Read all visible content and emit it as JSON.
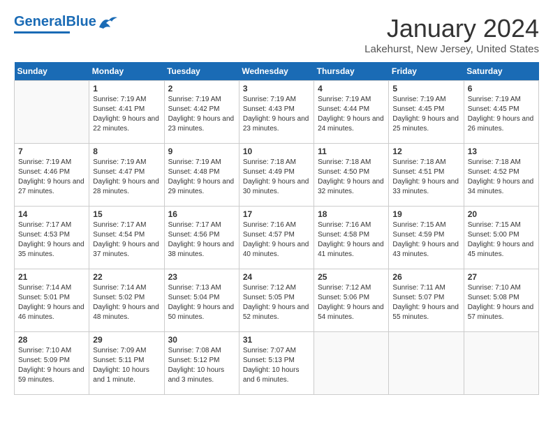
{
  "header": {
    "logo_general": "General",
    "logo_blue": "Blue",
    "month": "January 2024",
    "location": "Lakehurst, New Jersey, United States"
  },
  "weekdays": [
    "Sunday",
    "Monday",
    "Tuesday",
    "Wednesday",
    "Thursday",
    "Friday",
    "Saturday"
  ],
  "weeks": [
    [
      {
        "day": "",
        "sunrise": "",
        "sunset": "",
        "daylight": ""
      },
      {
        "day": "1",
        "sunrise": "Sunrise: 7:19 AM",
        "sunset": "Sunset: 4:41 PM",
        "daylight": "Daylight: 9 hours and 22 minutes."
      },
      {
        "day": "2",
        "sunrise": "Sunrise: 7:19 AM",
        "sunset": "Sunset: 4:42 PM",
        "daylight": "Daylight: 9 hours and 23 minutes."
      },
      {
        "day": "3",
        "sunrise": "Sunrise: 7:19 AM",
        "sunset": "Sunset: 4:43 PM",
        "daylight": "Daylight: 9 hours and 23 minutes."
      },
      {
        "day": "4",
        "sunrise": "Sunrise: 7:19 AM",
        "sunset": "Sunset: 4:44 PM",
        "daylight": "Daylight: 9 hours and 24 minutes."
      },
      {
        "day": "5",
        "sunrise": "Sunrise: 7:19 AM",
        "sunset": "Sunset: 4:45 PM",
        "daylight": "Daylight: 9 hours and 25 minutes."
      },
      {
        "day": "6",
        "sunrise": "Sunrise: 7:19 AM",
        "sunset": "Sunset: 4:45 PM",
        "daylight": "Daylight: 9 hours and 26 minutes."
      }
    ],
    [
      {
        "day": "7",
        "sunrise": "Sunrise: 7:19 AM",
        "sunset": "Sunset: 4:46 PM",
        "daylight": "Daylight: 9 hours and 27 minutes."
      },
      {
        "day": "8",
        "sunrise": "Sunrise: 7:19 AM",
        "sunset": "Sunset: 4:47 PM",
        "daylight": "Daylight: 9 hours and 28 minutes."
      },
      {
        "day": "9",
        "sunrise": "Sunrise: 7:19 AM",
        "sunset": "Sunset: 4:48 PM",
        "daylight": "Daylight: 9 hours and 29 minutes."
      },
      {
        "day": "10",
        "sunrise": "Sunrise: 7:18 AM",
        "sunset": "Sunset: 4:49 PM",
        "daylight": "Daylight: 9 hours and 30 minutes."
      },
      {
        "day": "11",
        "sunrise": "Sunrise: 7:18 AM",
        "sunset": "Sunset: 4:50 PM",
        "daylight": "Daylight: 9 hours and 32 minutes."
      },
      {
        "day": "12",
        "sunrise": "Sunrise: 7:18 AM",
        "sunset": "Sunset: 4:51 PM",
        "daylight": "Daylight: 9 hours and 33 minutes."
      },
      {
        "day": "13",
        "sunrise": "Sunrise: 7:18 AM",
        "sunset": "Sunset: 4:52 PM",
        "daylight": "Daylight: 9 hours and 34 minutes."
      }
    ],
    [
      {
        "day": "14",
        "sunrise": "Sunrise: 7:17 AM",
        "sunset": "Sunset: 4:53 PM",
        "daylight": "Daylight: 9 hours and 35 minutes."
      },
      {
        "day": "15",
        "sunrise": "Sunrise: 7:17 AM",
        "sunset": "Sunset: 4:54 PM",
        "daylight": "Daylight: 9 hours and 37 minutes."
      },
      {
        "day": "16",
        "sunrise": "Sunrise: 7:17 AM",
        "sunset": "Sunset: 4:56 PM",
        "daylight": "Daylight: 9 hours and 38 minutes."
      },
      {
        "day": "17",
        "sunrise": "Sunrise: 7:16 AM",
        "sunset": "Sunset: 4:57 PM",
        "daylight": "Daylight: 9 hours and 40 minutes."
      },
      {
        "day": "18",
        "sunrise": "Sunrise: 7:16 AM",
        "sunset": "Sunset: 4:58 PM",
        "daylight": "Daylight: 9 hours and 41 minutes."
      },
      {
        "day": "19",
        "sunrise": "Sunrise: 7:15 AM",
        "sunset": "Sunset: 4:59 PM",
        "daylight": "Daylight: 9 hours and 43 minutes."
      },
      {
        "day": "20",
        "sunrise": "Sunrise: 7:15 AM",
        "sunset": "Sunset: 5:00 PM",
        "daylight": "Daylight: 9 hours and 45 minutes."
      }
    ],
    [
      {
        "day": "21",
        "sunrise": "Sunrise: 7:14 AM",
        "sunset": "Sunset: 5:01 PM",
        "daylight": "Daylight: 9 hours and 46 minutes."
      },
      {
        "day": "22",
        "sunrise": "Sunrise: 7:14 AM",
        "sunset": "Sunset: 5:02 PM",
        "daylight": "Daylight: 9 hours and 48 minutes."
      },
      {
        "day": "23",
        "sunrise": "Sunrise: 7:13 AM",
        "sunset": "Sunset: 5:04 PM",
        "daylight": "Daylight: 9 hours and 50 minutes."
      },
      {
        "day": "24",
        "sunrise": "Sunrise: 7:12 AM",
        "sunset": "Sunset: 5:05 PM",
        "daylight": "Daylight: 9 hours and 52 minutes."
      },
      {
        "day": "25",
        "sunrise": "Sunrise: 7:12 AM",
        "sunset": "Sunset: 5:06 PM",
        "daylight": "Daylight: 9 hours and 54 minutes."
      },
      {
        "day": "26",
        "sunrise": "Sunrise: 7:11 AM",
        "sunset": "Sunset: 5:07 PM",
        "daylight": "Daylight: 9 hours and 55 minutes."
      },
      {
        "day": "27",
        "sunrise": "Sunrise: 7:10 AM",
        "sunset": "Sunset: 5:08 PM",
        "daylight": "Daylight: 9 hours and 57 minutes."
      }
    ],
    [
      {
        "day": "28",
        "sunrise": "Sunrise: 7:10 AM",
        "sunset": "Sunset: 5:09 PM",
        "daylight": "Daylight: 9 hours and 59 minutes."
      },
      {
        "day": "29",
        "sunrise": "Sunrise: 7:09 AM",
        "sunset": "Sunset: 5:11 PM",
        "daylight": "Daylight: 10 hours and 1 minute."
      },
      {
        "day": "30",
        "sunrise": "Sunrise: 7:08 AM",
        "sunset": "Sunset: 5:12 PM",
        "daylight": "Daylight: 10 hours and 3 minutes."
      },
      {
        "day": "31",
        "sunrise": "Sunrise: 7:07 AM",
        "sunset": "Sunset: 5:13 PM",
        "daylight": "Daylight: 10 hours and 6 minutes."
      },
      {
        "day": "",
        "sunrise": "",
        "sunset": "",
        "daylight": ""
      },
      {
        "day": "",
        "sunrise": "",
        "sunset": "",
        "daylight": ""
      },
      {
        "day": "",
        "sunrise": "",
        "sunset": "",
        "daylight": ""
      }
    ]
  ]
}
